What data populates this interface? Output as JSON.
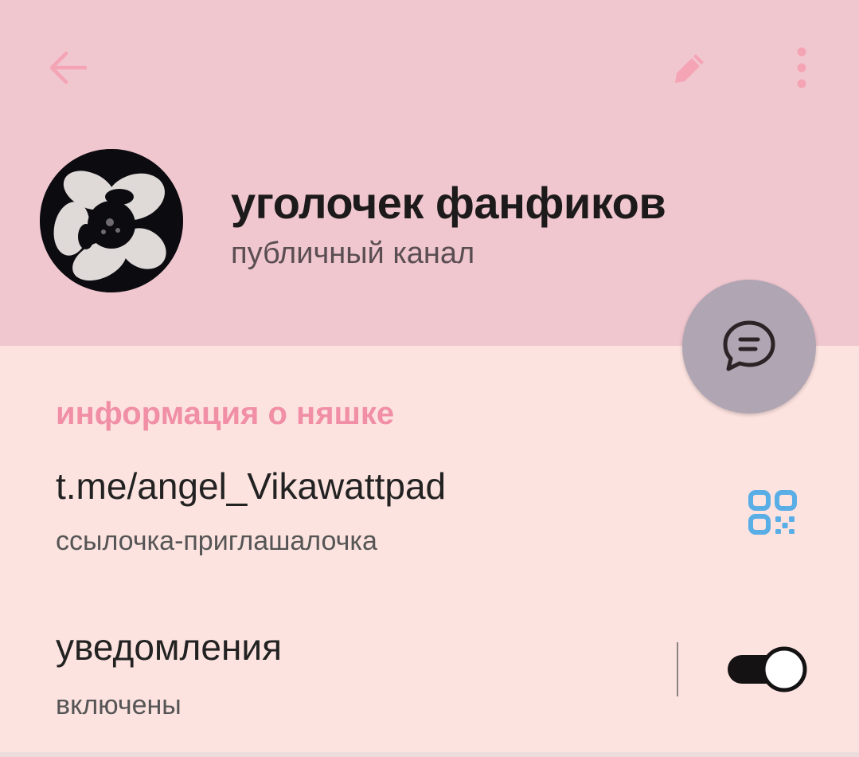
{
  "colors": {
    "header_bg": "#f0c6cf",
    "content_bg": "#fde3e0",
    "accent_pink": "#f08fa5",
    "fab_bg": "#b0a5b2",
    "qr_blue": "#5aaee6"
  },
  "toolbar": {
    "back_icon": "arrow-left-icon",
    "edit_icon": "pencil-icon",
    "more_icon": "more-vertical-icon"
  },
  "channel": {
    "title": "уголочек фанфиков",
    "subtitle": "публичный канал",
    "avatar_icon": "flower-avatar"
  },
  "fab": {
    "icon": "chat-bubble-icon"
  },
  "info_section": {
    "header": "информация о няшке",
    "link": "t.me/angel_Vikawattpad",
    "link_caption": "ссылочка-приглашалочка",
    "qr_icon": "qr-code-icon"
  },
  "notifications": {
    "title": "уведомления",
    "status": "включены",
    "enabled": true
  }
}
